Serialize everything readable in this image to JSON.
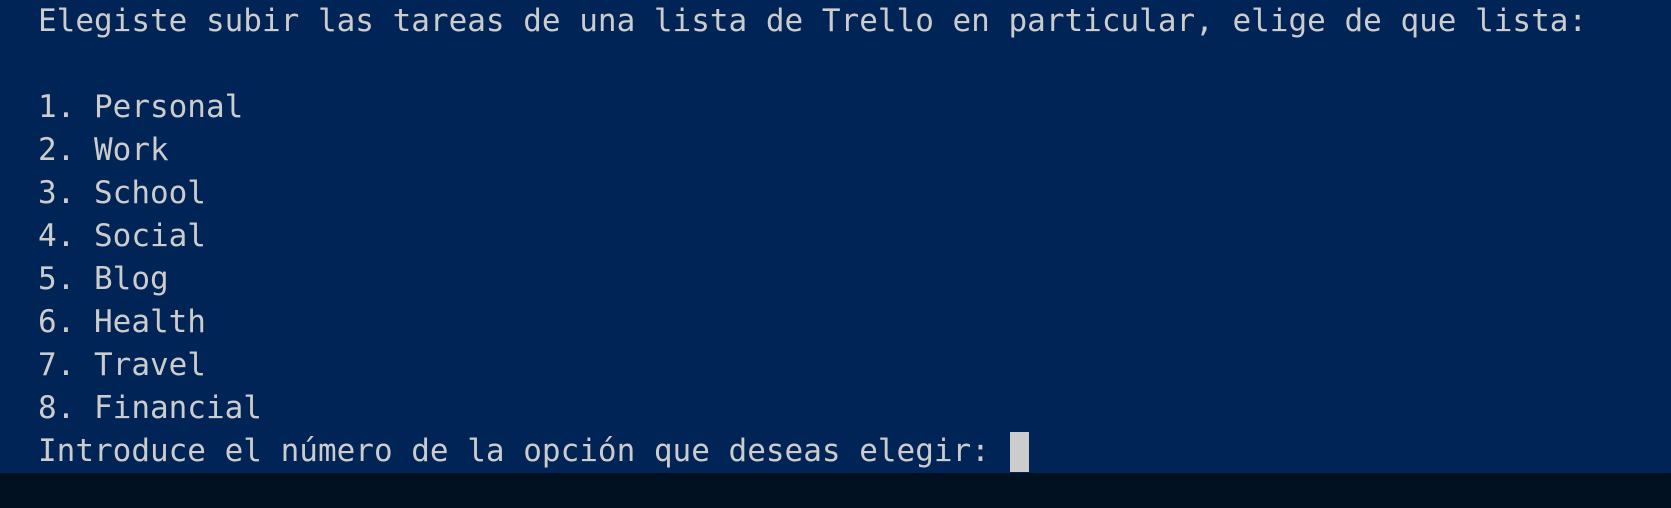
{
  "terminal": {
    "header_line": "Elegiste subir las tareas de una lista de Trello en particular, elige de que lista:",
    "options": [
      "1. Personal",
      "2. Work",
      "3. School",
      "4. Social",
      "5. Blog",
      "6. Health",
      "7. Travel",
      "8. Financial"
    ],
    "prompt": "Introduce el número de la opción que deseas elegir: ",
    "input_value": ""
  },
  "colors": {
    "background": "#012456",
    "text": "#cccccc",
    "cursor": "#cccccc"
  }
}
